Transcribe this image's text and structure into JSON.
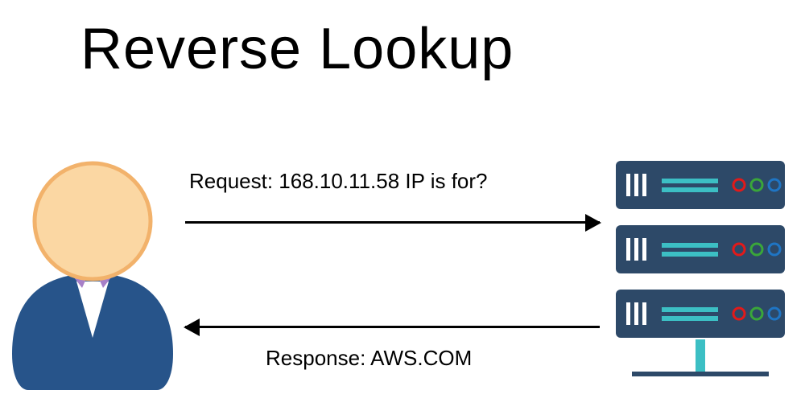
{
  "title": "Reverse Lookup",
  "request": "Request: 168.10.11.58 IP is for?",
  "response": "Response: AWS.COM",
  "colors": {
    "server_body": "#2d4968",
    "server_line": "#3cbfc4",
    "led_red": "#e21a1a",
    "led_green": "#3aa63a",
    "led_blue": "#1f75c4",
    "skin": "#fbd7a3",
    "skin_stroke": "#f2b26b",
    "suit": "#27548a",
    "collar": "#a780c8"
  }
}
